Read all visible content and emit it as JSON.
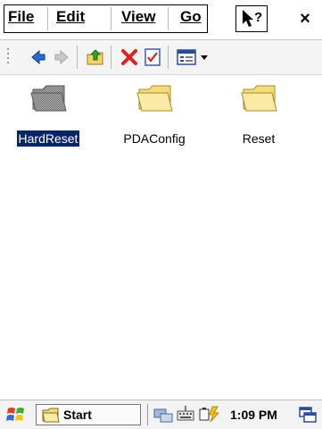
{
  "menu": {
    "file": "File",
    "edit": "Edit",
    "view": "View",
    "go": "Go",
    "help_icon": "what's-this-help-icon",
    "close": "×"
  },
  "toolbar": {
    "icons": [
      "back-arrow-icon",
      "forward-arrow-icon",
      "up-folder-icon",
      "delete-icon",
      "properties-icon",
      "view-mode-icon"
    ]
  },
  "files": [
    {
      "name": "HardReset",
      "selected": true,
      "icon": "folder-icon"
    },
    {
      "name": "PDAConfig",
      "selected": false,
      "icon": "folder-icon"
    },
    {
      "name": "Reset",
      "selected": false,
      "icon": "folder-icon"
    }
  ],
  "taskbar": {
    "start_label": "Start",
    "time": "1:09 PM",
    "tray_icons": [
      "network-icon",
      "keyboard-icon",
      "battery-icon",
      "desktop-icon"
    ]
  },
  "colors": {
    "selection": "#0a246a",
    "folder": "#f9e48a",
    "folder_selected": "#8a8a8a"
  }
}
